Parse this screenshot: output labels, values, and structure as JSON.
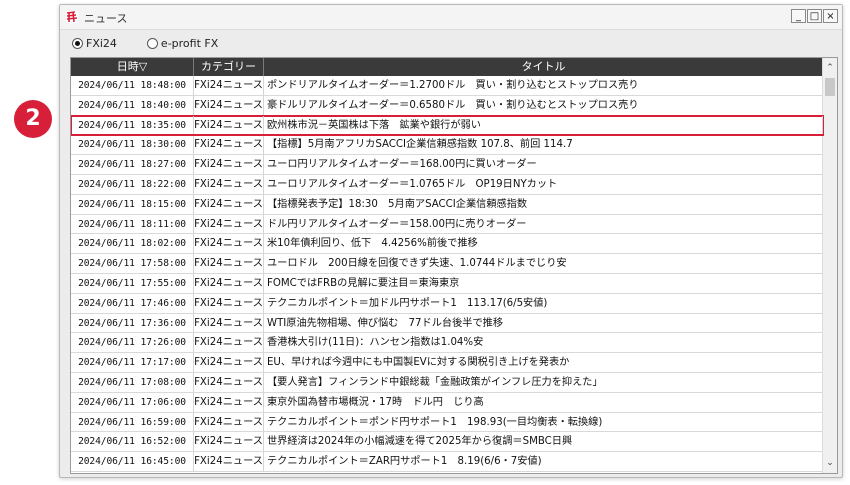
{
  "window": {
    "title": "ニュース",
    "buttons": [
      "_",
      "□",
      "×"
    ]
  },
  "source_options": [
    {
      "label": "FXi24",
      "selected": true
    },
    {
      "label": "e-profit FX",
      "selected": false
    }
  ],
  "table": {
    "columns": [
      "日時▽",
      "カテゴリー",
      "タイトル"
    ],
    "rows": [
      {
        "date": "2024/06/11 18:48:00",
        "category": "FXi24ニュース",
        "title": "ポンドリアルタイムオーダー＝1.2700ドル　買い・割り込むとストップロス売り"
      },
      {
        "date": "2024/06/11 18:40:00",
        "category": "FXi24ニュース",
        "title": "豪ドルリアルタイムオーダー＝0.6580ドル　買い・割り込むとストップロス売り"
      },
      {
        "date": "2024/06/11 18:35:00",
        "category": "FXi24ニュース",
        "title": "欧州株市況－英国株は下落　鉱業や銀行が弱い"
      },
      {
        "date": "2024/06/11 18:30:00",
        "category": "FXi24ニュース",
        "title": "【指標】5月南アフリカSACCI企業信頼感指数 107.8、前回 114.7"
      },
      {
        "date": "2024/06/11 18:27:00",
        "category": "FXi24ニュース",
        "title": "ユーロ円リアルタイムオーダー＝168.00円に買いオーダー"
      },
      {
        "date": "2024/06/11 18:22:00",
        "category": "FXi24ニュース",
        "title": "ユーロリアルタイムオーダー＝1.0765ドル　OP19日NYカット"
      },
      {
        "date": "2024/06/11 18:15:00",
        "category": "FXi24ニュース",
        "title": "【指標発表予定】18:30　5月南アSACCI企業信頼感指数"
      },
      {
        "date": "2024/06/11 18:11:00",
        "category": "FXi24ニュース",
        "title": "ドル円リアルタイムオーダー＝158.00円に売りオーダー"
      },
      {
        "date": "2024/06/11 18:02:00",
        "category": "FXi24ニュース",
        "title": "米10年債利回り、低下　4.4256%前後で推移"
      },
      {
        "date": "2024/06/11 17:58:00",
        "category": "FXi24ニュース",
        "title": "ユーロドル　200日線を回復できず失速、1.0744ドルまでじり安"
      },
      {
        "date": "2024/06/11 17:55:00",
        "category": "FXi24ニュース",
        "title": "FOMCではFRBの見解に要注目＝東海東京"
      },
      {
        "date": "2024/06/11 17:46:00",
        "category": "FXi24ニュース",
        "title": "テクニカルポイント＝加ドル円サポート1　113.17(6/5安値)"
      },
      {
        "date": "2024/06/11 17:36:00",
        "category": "FXi24ニュース",
        "title": "WTI原油先物相場、伸び悩む　77ドル台後半で推移"
      },
      {
        "date": "2024/06/11 17:26:00",
        "category": "FXi24ニュース",
        "title": "香港株大引け(11日)：ハンセン指数は1.04%安"
      },
      {
        "date": "2024/06/11 17:17:00",
        "category": "FXi24ニュース",
        "title": "EU、早ければ今週中にも中国製EVに対する関税引き上げを発表か"
      },
      {
        "date": "2024/06/11 17:08:00",
        "category": "FXi24ニュース",
        "title": "【要人発言】フィンランド中銀総裁「金融政策がインフレ圧力を抑えた」"
      },
      {
        "date": "2024/06/11 17:06:00",
        "category": "FXi24ニュース",
        "title": "東京外国為替市場概況・17時　ドル円　じり高"
      },
      {
        "date": "2024/06/11 16:59:00",
        "category": "FXi24ニュース",
        "title": "テクニカルポイント＝ポンド円サポート1　198.93(一目均衡表・転換線)"
      },
      {
        "date": "2024/06/11 16:52:00",
        "category": "FXi24ニュース",
        "title": "世界経済は2024年の小幅減速を得て2025年から復調＝SMBC日興"
      },
      {
        "date": "2024/06/11 16:45:00",
        "category": "FXi24ニュース",
        "title": "テクニカルポイント＝ZAR円サポート1　8.19(6/6・7安値)"
      }
    ],
    "selected_row_index": 2
  },
  "annotation": {
    "badge_number": "2",
    "color": "#d81f3a"
  },
  "icons": {
    "app": "news-app-icon",
    "scroll_up": "chevron-up-icon",
    "scroll_down": "chevron-down-icon"
  }
}
